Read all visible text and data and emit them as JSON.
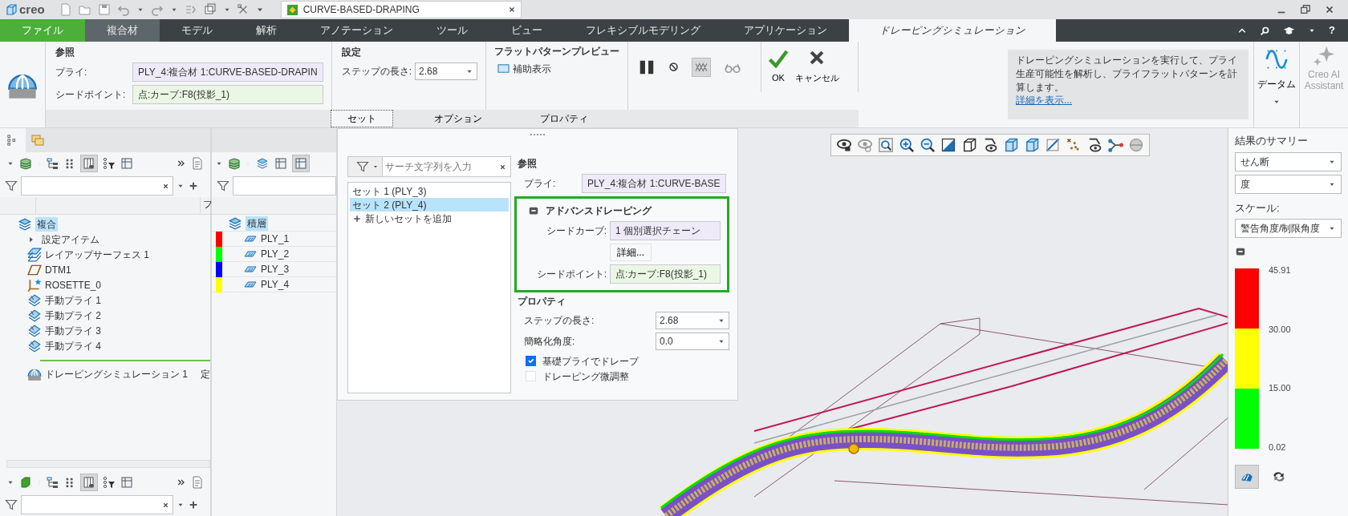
{
  "title_bar": {
    "app_name": "creo",
    "document_tab": "CURVE-BASED-DRAPING"
  },
  "menu_tabs": [
    {
      "label": "ファイル",
      "kind": "file",
      "selected": false
    },
    {
      "label": "複合材",
      "kind": "context",
      "selected": false
    },
    {
      "label": "モデル",
      "kind": "normal",
      "selected": false
    },
    {
      "label": "解析",
      "kind": "normal",
      "selected": false
    },
    {
      "label": "アノテーション",
      "kind": "normal",
      "selected": false
    },
    {
      "label": "ツール",
      "kind": "normal",
      "selected": false
    },
    {
      "label": "ビュー",
      "kind": "normal",
      "selected": false
    },
    {
      "label": "フレキシブルモデリング",
      "kind": "normal",
      "selected": false
    },
    {
      "label": "アプリケーション",
      "kind": "normal",
      "selected": false
    },
    {
      "label": "ドレーピングシミュレーション",
      "kind": "normal",
      "selected": true
    }
  ],
  "help": "?",
  "ribbon": {
    "reference": {
      "title": "参照",
      "ply_label": "プライ:",
      "ply_value": "PLY_4:複合材 1:CURVE-BASED-DRAPIN",
      "seed_point_label": "シードポイント:",
      "seed_point_value": "点:カーブ:F8(投影_1)"
    },
    "settings": {
      "title": "設定",
      "step_label": "ステップの長さ:",
      "step_value": "2.68"
    },
    "flat_preview": {
      "title": "フラットパターンプレビュー",
      "assist_label": "補助表示",
      "assist_checked": false
    },
    "actions": {
      "ok": "OK",
      "cancel": "キャンセル"
    },
    "info": {
      "text": "ドレーピングシミュレーションを実行して、プライ生産可能性を解析し、プライフラットパターンを計算します。",
      "link": "詳細を表示..."
    },
    "datum": "データム",
    "ai_assistant": {
      "label": "Creo AI Assistant",
      "disabled": true
    },
    "tabs": [
      {
        "label": "セット",
        "selected": true
      },
      {
        "label": "オプション",
        "selected": false
      },
      {
        "label": "プロパティ",
        "selected": false
      }
    ]
  },
  "model_tree": {
    "column_header": "フ",
    "items": [
      {
        "label": "複合",
        "kind": "composite",
        "selected": true,
        "children": [
          {
            "label": "設定アイテム",
            "kind": "folder",
            "selected": false,
            "expanded": false
          },
          {
            "label": "レイアップサーフェス 1",
            "kind": "surface",
            "selected": false
          },
          {
            "label": "DTM1",
            "kind": "datum",
            "selected": false
          },
          {
            "label": "ROSETTE_0",
            "kind": "rosette",
            "selected": false
          },
          {
            "label": "手動プライ 1",
            "kind": "ply",
            "selected": false
          },
          {
            "label": "手動プライ 2",
            "kind": "ply",
            "selected": false
          },
          {
            "label": "手動プライ 3",
            "kind": "ply",
            "selected": false
          },
          {
            "label": "手動プライ 4",
            "kind": "ply",
            "selected": false
          },
          {
            "label": "ドレーピングシミュレーション 1",
            "kind": "simulation",
            "selected": false,
            "insert_marker": true,
            "status": "定"
          }
        ]
      }
    ]
  },
  "ply_tree": {
    "items": [
      {
        "label": "積層",
        "selected": true,
        "children": [
          {
            "label": "PLY_1",
            "selected": false,
            "color": "#ff0000"
          },
          {
            "label": "PLY_2",
            "selected": false,
            "color": "#00ff00"
          },
          {
            "label": "PLY_3",
            "selected": false,
            "color": "#0000ff"
          },
          {
            "label": "PLY_4",
            "selected": false,
            "color": "#ffff00"
          }
        ]
      }
    ]
  },
  "sets_panel": {
    "search_placeholder": "サーチ文字列を入力",
    "sets": [
      {
        "label": "セット 1 (PLY_3)",
        "selected": false
      },
      {
        "label": "セット 2 (PLY_4)",
        "selected": true
      }
    ],
    "add_label": "新しいセットを追加",
    "reference_title": "参照",
    "ply_label": "プライ:",
    "ply_value": "PLY_4:複合材 1:CURVE-BASE",
    "advanced": {
      "title": "アドバンスドレーピング",
      "expanded": true,
      "seed_curve_label": "シードカーブ:",
      "seed_curve_value": "1 個別選択チェーン",
      "details_button": "詳細...",
      "seed_point_label": "シードポイント:",
      "seed_point_value": "点:カーブ:F8(投影_1)"
    },
    "properties_title": "プロパティ",
    "step_label": "ステップの長さ:",
    "step_value": "2.68",
    "simplify_label": "簡略化角度:",
    "simplify_value": "0.0",
    "options": [
      {
        "label": "基礎プライでドレープ",
        "checked": true
      },
      {
        "label": "ドレーピング微調整",
        "checked": false
      }
    ]
  },
  "results": {
    "title": "結果のサマリー",
    "type_value": "せん断",
    "unit_value": "度",
    "scale_label": "スケール:",
    "scale_value": "警告角度/制限角度",
    "legend": {
      "bands": [
        {
          "color": "#ff0000"
        },
        {
          "color": "#ffff00"
        },
        {
          "color": "#00ff00"
        }
      ],
      "ticks": [
        "45.91",
        "30.00",
        "15.00",
        "0.02"
      ]
    }
  }
}
